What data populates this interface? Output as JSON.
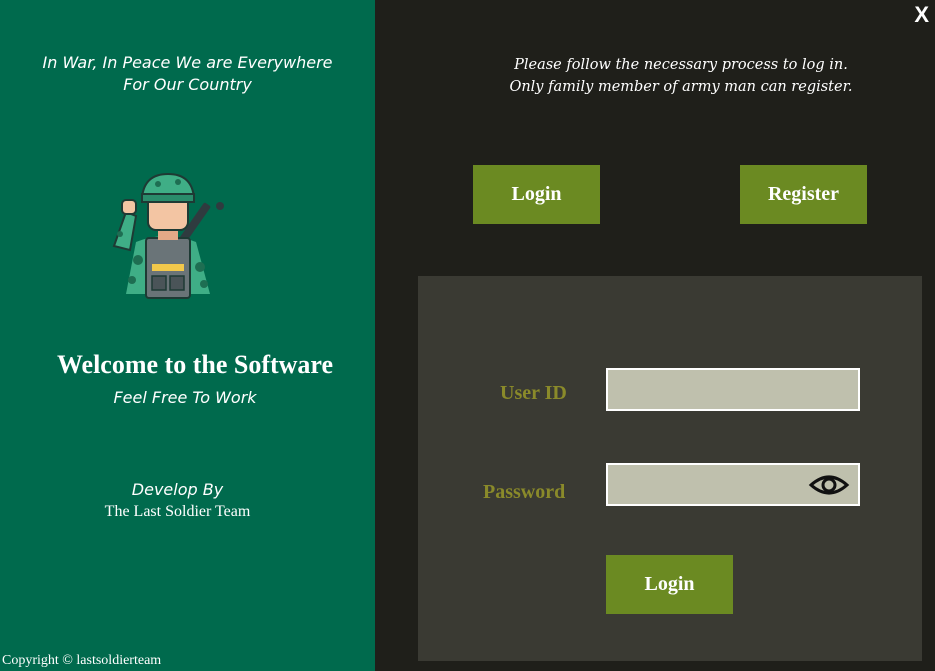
{
  "left": {
    "tagline_line1": "In War, In Peace We are Everywhere",
    "tagline_line2": "For Our Country",
    "welcome": "Welcome to the Software",
    "subtitle": "Feel Free To Work",
    "develop_by": "Develop By",
    "team": "The Last Soldier Team",
    "copyright": "Copyright © lastsoldierteam"
  },
  "right": {
    "close_label": "X",
    "notice_line1": "Please follow the necessary process to log in.",
    "notice_line2": "Only family member of army man can register.",
    "tab_login": "Login",
    "tab_register": "Register",
    "form": {
      "userid_label": "User ID",
      "userid_value": "",
      "password_label": "Password",
      "password_value": "",
      "submit_label": "Login"
    }
  },
  "colors": {
    "left_bg": "#006a4d",
    "right_bg": "#1f1f1a",
    "panel_bg": "#3a3a33",
    "button": "#6b8a22",
    "label": "#8a8a2a",
    "field": "#bfc0ad"
  },
  "icons": [
    "soldier-saluting-icon",
    "eye-icon",
    "close-icon"
  ]
}
